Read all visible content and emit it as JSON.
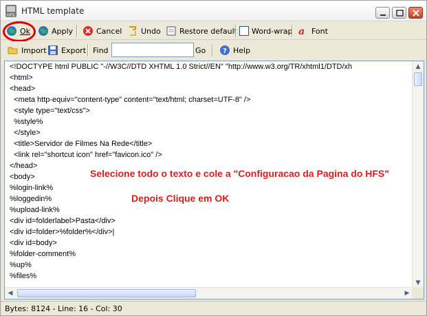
{
  "window": {
    "title": "HTML template"
  },
  "toolbar1": {
    "ok": "Ok",
    "apply": "Apply",
    "cancel": "Cancel",
    "undo": "Undo",
    "restore": "Restore default",
    "wordwrap": "Word-wrap",
    "font": "Font"
  },
  "toolbar2": {
    "import": "Import",
    "export": "Export",
    "find": "Find",
    "find_value": "",
    "go": "Go",
    "help": "Help"
  },
  "editor": {
    "lines": [
      "<!DOCTYPE html PUBLIC \"-//W3C//DTD XHTML 1.0 Strict//EN\" \"http://www.w3.org/TR/xhtml1/DTD/xh",
      "<html>",
      "<head>",
      "  <meta http-equiv=\"content-type\" content=\"text/html; charset=UTF-8\" />",
      "  <style type=\"text/css\">",
      "  %style%",
      "  </style>",
      "  <title>Servidor de Filmes Na Rede</title>",
      "  <link rel=\"shortcut icon\" href=\"favicon.ico\" />",
      "</head>",
      "<body>",
      "%login-link%",
      "%loggedin%",
      "%upload-link%",
      "<div id=folderlabel>Pasta</div>",
      "<div id=folder>%folder%</div>|",
      "<div id=body>",
      "%folder-comment%",
      "%up%",
      "%files%"
    ]
  },
  "annotations": {
    "note1": "Selecione todo o texto e cole a \"Configuracao da Pagina do HFS\"",
    "note2": "Depois Clique em OK"
  },
  "status": {
    "text": "Bytes: 8124 - Line: 16 - Col: 30"
  },
  "colors": {
    "annotation": "#d42020",
    "highlight_circle": "#e00000"
  }
}
